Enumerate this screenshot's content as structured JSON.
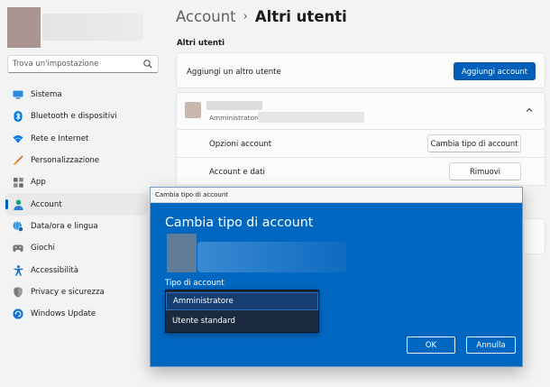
{
  "sidebar": {
    "search_placeholder": "Trova un'impostazione",
    "items": [
      {
        "label": "Sistema",
        "icon": "monitor-icon",
        "color": "#0078d4"
      },
      {
        "label": "Bluetooth e dispositivi",
        "icon": "bluetooth-icon",
        "color": "#0078d4"
      },
      {
        "label": "Rete e Internet",
        "icon": "wifi-icon",
        "color": "#0078d4"
      },
      {
        "label": "Personalizzazione",
        "icon": "brush-icon",
        "color": "#d0622c"
      },
      {
        "label": "App",
        "icon": "apps-icon",
        "color": "#6b6b6b"
      },
      {
        "label": "Account",
        "icon": "person-icon",
        "color": "#1aa27c",
        "active": true
      },
      {
        "label": "Data/ora e lingua",
        "icon": "globe-clock-icon",
        "color": "#0078d4"
      },
      {
        "label": "Giochi",
        "icon": "gamepad-icon",
        "color": "#6b6b6b"
      },
      {
        "label": "Accessibilità",
        "icon": "accessibility-icon",
        "color": "#0078d4"
      },
      {
        "label": "Privacy e sicurezza",
        "icon": "shield-icon",
        "color": "#7a7a7a"
      },
      {
        "label": "Windows Update",
        "icon": "update-icon",
        "color": "#0078d4"
      }
    ]
  },
  "header": {
    "parent": "Account",
    "separator": "›",
    "current": "Altri utenti"
  },
  "main": {
    "section_title": "Altri utenti",
    "add_user_label": "Aggiungi un altro utente",
    "add_account_button": "Aggiungi account",
    "user_role": "Amministratore ·",
    "account_options_label": "Opzioni account",
    "change_type_button": "Cambia tipo di account",
    "account_data_label": "Account e dati",
    "remove_button": "Rimuovi"
  },
  "dialog": {
    "window_title": "Cambia tipo di account",
    "heading": "Cambia tipo di account",
    "field_label": "Tipo di account",
    "options": [
      "Amministratore",
      "Utente standard"
    ],
    "selected": "Amministratore",
    "ok_button": "OK",
    "cancel_button": "Annulla"
  },
  "colors": {
    "accent": "#005fb8",
    "dialog_background": "#0067c0",
    "dropdown_background": "#1b2a3f"
  }
}
